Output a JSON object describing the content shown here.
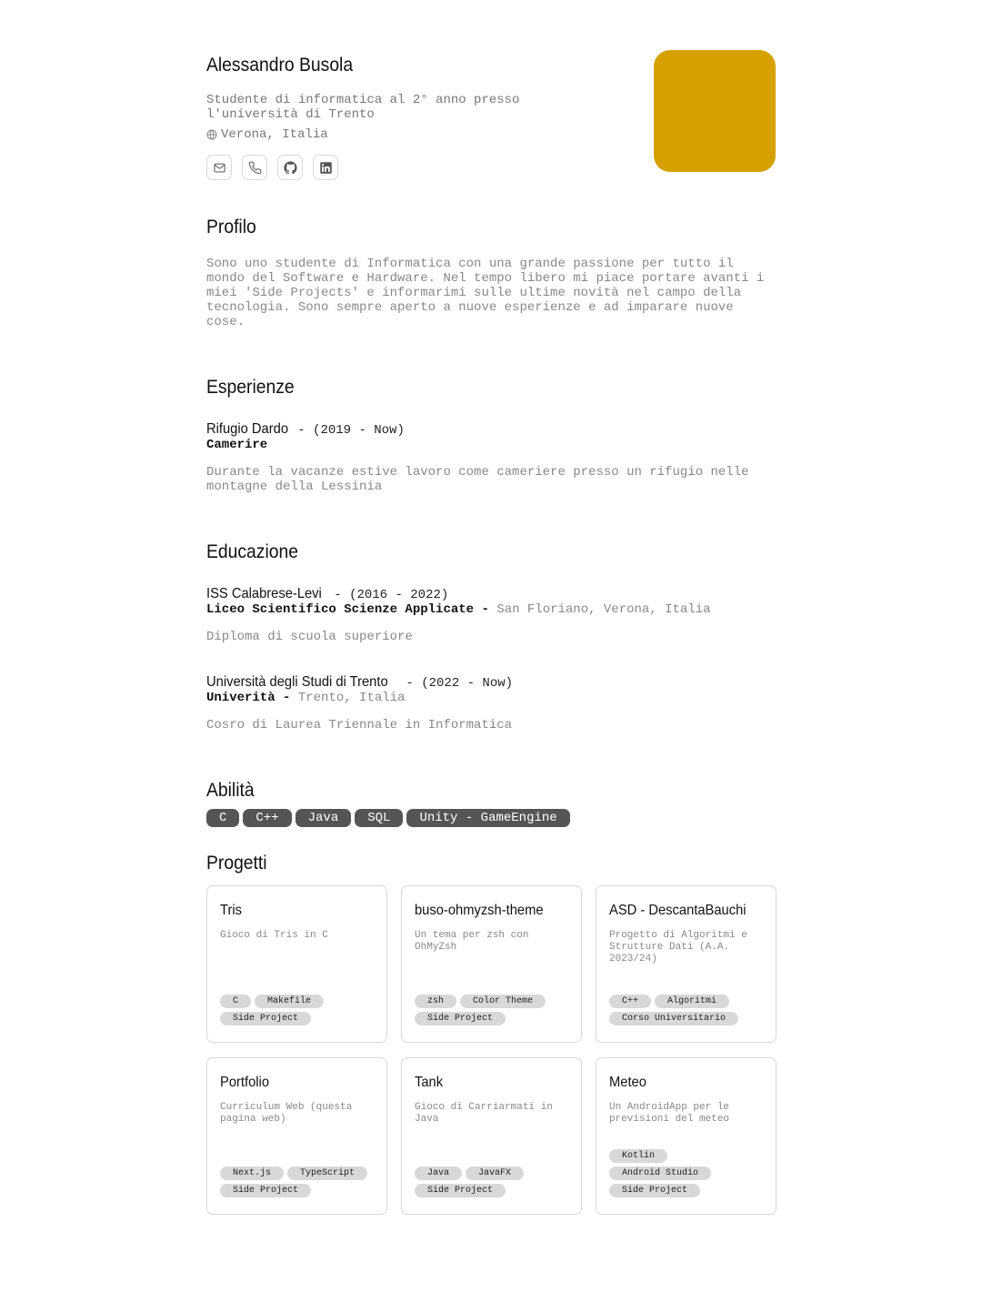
{
  "header": {
    "name": "Alessandro Busola",
    "tagline": "Studente di informatica al 2° anno presso l'università di Trento",
    "location": "Verona, Italia",
    "avatar_color": "#d6a100",
    "contacts": [
      {
        "icon": "mail-icon"
      },
      {
        "icon": "phone-icon"
      },
      {
        "icon": "github-icon"
      },
      {
        "icon": "linkedin-icon"
      }
    ]
  },
  "profile": {
    "title": "Profilo",
    "text": "Sono uno studente di Informatica con una grande passione per tutto il mondo del Software e Hardware. Nel tempo libero mi piace portare avanti i miei 'Side Projects' e informarimi sulle ultime novità nel campo della tecnologia. Sono sempre aperto a nuove esperienze e ad imparare nuove cose."
  },
  "experience": {
    "title": "Esperienze",
    "items": [
      {
        "org": "Rifugio Dardo",
        "period": "(2019 - Now)",
        "role": "Camerire",
        "place": "",
        "desc": "Durante la vacanze estive lavoro come cameriere presso un rifugio nelle montagne della Lessinia"
      }
    ]
  },
  "education": {
    "title": "Educazione",
    "items": [
      {
        "org": "ISS Calabrese-Levi",
        "period": "(2016 - 2022)",
        "role": "Liceo Scientifico Scienze Applicate",
        "place": "San Floriano, Verona, Italia",
        "desc": "Diploma di scuola superiore"
      },
      {
        "org": "Università degli Studi di Trento",
        "period": "(2022 - Now)",
        "role": "Univerità",
        "place": "Trento, Italia",
        "desc": "Cosro di Laurea Triennale in Informatica"
      }
    ]
  },
  "skills": {
    "title": "Abilità",
    "items": [
      "C",
      "C++",
      "Java",
      "SQL",
      "Unity - GameEngine"
    ]
  },
  "projects": {
    "title": "Progetti",
    "items": [
      {
        "title": "Tris",
        "desc": "Gioco di Tris in C",
        "tags": [
          "C",
          "Makefile",
          "Side Project"
        ]
      },
      {
        "title": "buso-ohmyzsh-theme",
        "desc": "Un tema per zsh con OhMyZsh",
        "tags": [
          "zsh",
          "Color Theme",
          "Side Project"
        ]
      },
      {
        "title": "ASD - DescantaBauchi",
        "desc": "Progetto di Algoritmi e Strutture Dati (A.A. 2023/24)",
        "tags": [
          "C++",
          "Algoritmi",
          "Corso Universitario"
        ]
      },
      {
        "title": "Portfolio",
        "desc": "Curriculum Web (questa pagina web)",
        "tags": [
          "Next.js",
          "TypeScript",
          "Side Project"
        ]
      },
      {
        "title": "Tank",
        "desc": "Gioco di Carriarmati in Java",
        "tags": [
          "Java",
          "JavaFX",
          "Side Project"
        ]
      },
      {
        "title": "Meteo",
        "desc": "Un AndroidApp per le previsioni del meteo",
        "tags": [
          "Kotlin",
          "Android Studio",
          "Side Project"
        ]
      }
    ]
  }
}
